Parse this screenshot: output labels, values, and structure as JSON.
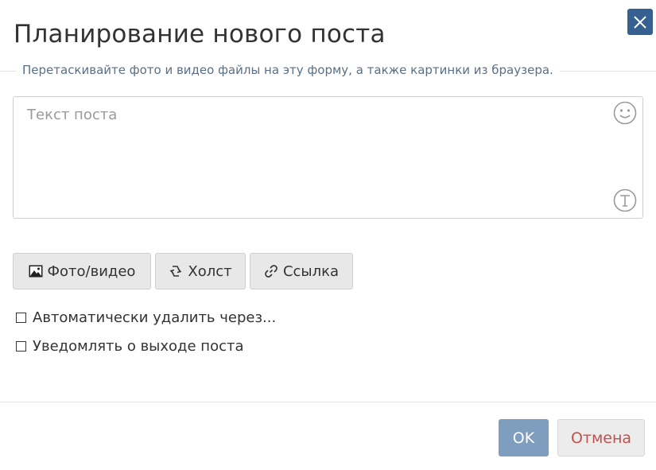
{
  "dialog": {
    "title": "Планирование нового поста",
    "hint": "Перетаскивайте фото и видео файлы на эту форму, а также картинки из браузера."
  },
  "post": {
    "placeholder": "Текст поста",
    "value": ""
  },
  "attach": {
    "photo_label": "Фото/видео",
    "canvas_label": "Холст",
    "link_label": "Ссылка"
  },
  "options": {
    "auto_delete_label": "Автоматически удалить через...",
    "auto_delete_checked": false,
    "notify_label": "Уведомлять о выходе поста",
    "notify_checked": false
  },
  "footer": {
    "ok_label": "OK",
    "cancel_label": "Отмена"
  },
  "colors": {
    "close_bg": "#35608f",
    "ok_bg": "#7e9dbf",
    "cancel_text": "#c0504d",
    "hint_text": "#5a6f85"
  }
}
